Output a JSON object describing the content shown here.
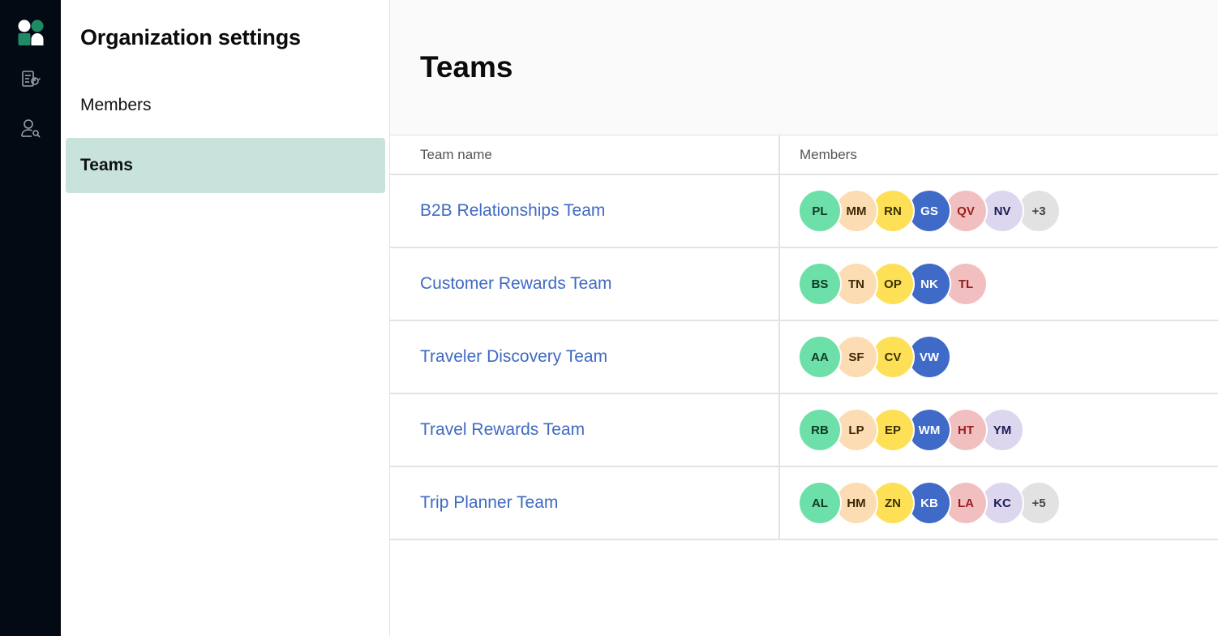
{
  "sidebar": {
    "title": "Organization settings",
    "items": [
      {
        "label": "Members",
        "active": false
      },
      {
        "label": "Teams",
        "active": true
      }
    ]
  },
  "page": {
    "title": "Teams",
    "columns": {
      "team_name": "Team name",
      "members": "Members"
    }
  },
  "teams": [
    {
      "name": "B2B Relationships Team",
      "members": [
        "PL",
        "MM",
        "RN",
        "GS",
        "QV",
        "NV"
      ],
      "overflow": "+3"
    },
    {
      "name": "Customer Rewards Team",
      "members": [
        "BS",
        "TN",
        "OP",
        "NK",
        "TL"
      ],
      "overflow": ""
    },
    {
      "name": "Traveler Discovery Team",
      "members": [
        "AA",
        "SF",
        "CV",
        "VW"
      ],
      "overflow": ""
    },
    {
      "name": "Travel Rewards Team",
      "members": [
        "RB",
        "LP",
        "EP",
        "WM",
        "HT",
        "YM"
      ],
      "overflow": ""
    },
    {
      "name": "Trip Planner Team",
      "members": [
        "AL",
        "HM",
        "ZN",
        "KB",
        "LA",
        "KC"
      ],
      "overflow": "+5"
    }
  ],
  "colors": {
    "rail": "#040a14",
    "active_nav": "#c7e3dc",
    "link": "#3f6ac2",
    "brand_green": "#1f8a64"
  },
  "icons": {
    "logo": "app-logo-icon",
    "rail": [
      "reports-icon",
      "user-search-icon"
    ]
  }
}
